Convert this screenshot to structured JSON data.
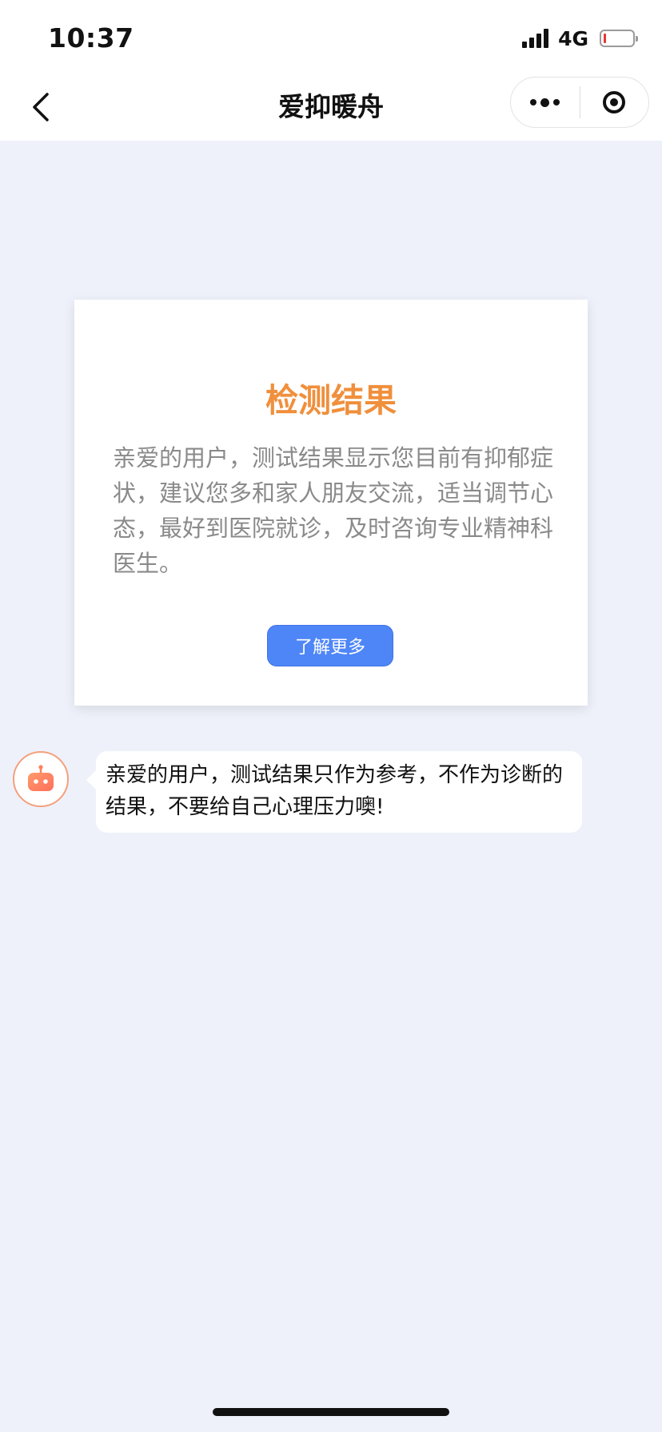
{
  "status_bar": {
    "time": "10:37",
    "network": "4G",
    "battery_level": 0.05
  },
  "nav": {
    "title": "爱抑暖舟",
    "icons": {
      "back": "chevron-left-icon",
      "more": "more-dots-icon",
      "close": "target-icon"
    }
  },
  "result_card": {
    "title": "检测结果",
    "body": "亲爱的用户，测试结果显示您目前有抑郁症状，建议您多和家人朋友交流，适当调节心态，最好到医院就诊，及时咨询专业精神科医生。",
    "button_label": "了解更多"
  },
  "bot_message": {
    "avatar_icon": "robot-icon",
    "text": "亲爱的用户，测试结果只作为参考，不作为诊断的结果，不要给自己心理压力噢!"
  },
  "colors": {
    "accent_orange": "#f08f3c",
    "button_blue": "#4f86f7",
    "page_background": "#eef1fa",
    "battery_low": "#e53935"
  }
}
